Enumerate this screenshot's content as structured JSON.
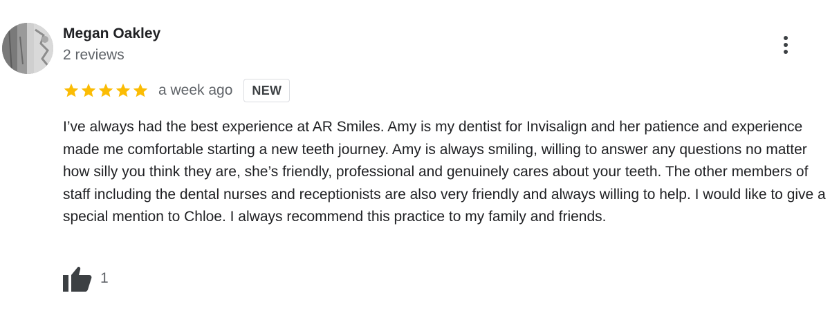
{
  "review": {
    "author": {
      "name": "Megan Oakley",
      "review_count": "2 reviews",
      "avatar": "profile-photo"
    },
    "rating": 5,
    "rating_max": 5,
    "date": "a week ago",
    "badge": "NEW",
    "text": "I’ve always had the best experience at AR Smiles. Amy is my dentist for Invisalign and her patience and experience made me comfortable starting a new teeth journey. Amy is always smiling, willing to answer any questions no matter how silly you think they are, she’s friendly, professional and genuinely cares about your teeth. The other members of staff including the dental nurses and receptionists are also very friendly and always willing to help. I would like to give a special mention to Chloe. I always recommend this practice to my family and friends.",
    "likes": "1",
    "icons": {
      "more": "more-vert-icon",
      "star": "star-icon",
      "like": "thumb-up-icon"
    }
  },
  "colors": {
    "star": "#FBBC04",
    "text_primary": "#202124",
    "text_secondary": "#5f6368",
    "icon_dark": "#3c4043",
    "badge_border": "#dadce0"
  }
}
